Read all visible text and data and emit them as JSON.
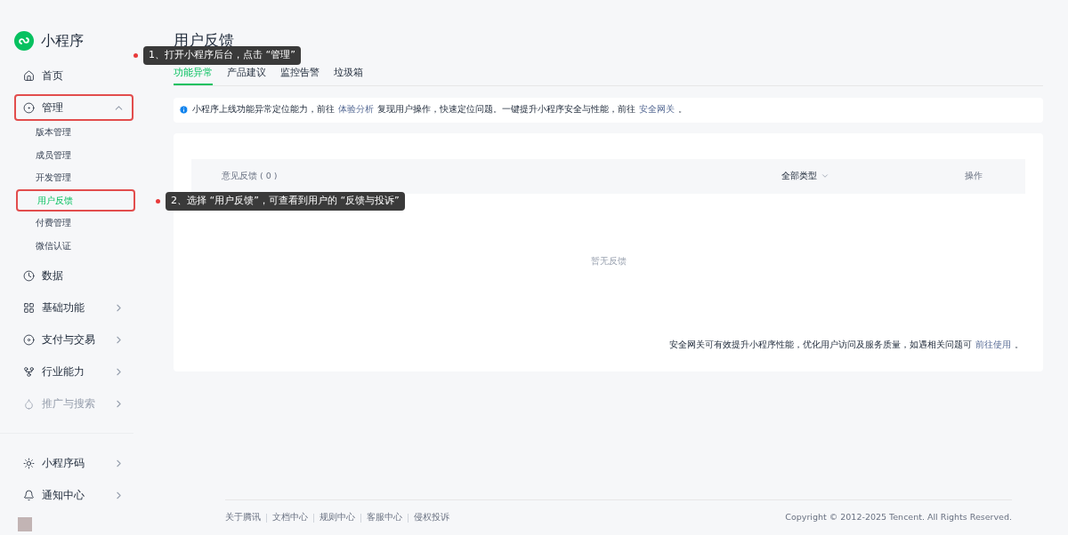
{
  "sidebar": {
    "logo_text": "小程序",
    "nav": [
      {
        "label": "首页",
        "kind": "item",
        "dimmed": false,
        "highlighted": false
      },
      {
        "label": "管理",
        "kind": "group",
        "expanded": true,
        "dimmed": false,
        "highlighted": true,
        "children": [
          {
            "label": "版本管理",
            "selected": false,
            "highlighted": false
          },
          {
            "label": "成员管理",
            "selected": false,
            "highlighted": false
          },
          {
            "label": "开发管理",
            "selected": false,
            "highlighted": false
          },
          {
            "label": "用户反馈",
            "selected": true,
            "highlighted": true
          },
          {
            "label": "付费管理",
            "selected": false,
            "highlighted": false
          },
          {
            "label": "微信认证",
            "selected": false,
            "highlighted": false
          }
        ]
      },
      {
        "label": "数据",
        "kind": "item",
        "dimmed": false,
        "highlighted": false
      },
      {
        "label": "基础功能",
        "kind": "group",
        "expanded": false,
        "dimmed": false,
        "highlighted": false
      },
      {
        "label": "支付与交易",
        "kind": "group",
        "expanded": false,
        "dimmed": false,
        "highlighted": false
      },
      {
        "label": "行业能力",
        "kind": "group",
        "expanded": false,
        "dimmed": false,
        "highlighted": false
      },
      {
        "label": "推广与搜索",
        "kind": "group",
        "expanded": false,
        "dimmed": true,
        "highlighted": false
      }
    ],
    "bottom_nav": [
      {
        "label": "小程序码",
        "kind": "group",
        "expanded": false,
        "dimmed": false,
        "highlighted": false
      },
      {
        "label": "通知中心",
        "kind": "group",
        "expanded": false,
        "dimmed": false,
        "highlighted": false
      }
    ]
  },
  "page_title": "用户反馈",
  "tabs": [
    {
      "label": "功能异常",
      "selected": true
    },
    {
      "label": "产品建议",
      "selected": false
    },
    {
      "label": "监控告警",
      "selected": false
    },
    {
      "label": "垃圾箱",
      "selected": false
    }
  ],
  "notice": {
    "parts": [
      {
        "kind": "text",
        "text": "小程序上线功能异常定位能力，前往"
      },
      {
        "kind": "link",
        "text": "体验分析"
      },
      {
        "kind": "text",
        "text": "复现用户操作，快速定位问题。一键提升小程序安全与性能，前往"
      },
      {
        "kind": "link",
        "text": "安全网关"
      },
      {
        "kind": "text",
        "text": "。"
      }
    ]
  },
  "table": {
    "columns": [
      {
        "label": "意见反馈 ( 0 )",
        "kind": "plain"
      },
      {
        "label": "全部类型",
        "kind": "filter"
      },
      {
        "label": "操作",
        "kind": "plain"
      }
    ],
    "empty_text": "暂无反馈"
  },
  "bottom_note": {
    "parts": [
      {
        "kind": "text",
        "text": "安全网关可有效提升小程序性能，优化用户访问及服务质量，如遇相关问题可"
      },
      {
        "kind": "link",
        "text": "前往使用"
      },
      {
        "kind": "text",
        "text": "。"
      }
    ]
  },
  "footer": {
    "links": [
      "关于腾讯",
      "文档中心",
      "规则中心",
      "客服中心",
      "侵权投诉"
    ],
    "copyright": "Copyright © 2012-2025 Tencent. All Rights Reserved."
  },
  "callouts": [
    {
      "text": "1、打开小程序后台，点击 “管理”"
    },
    {
      "text": "2、选择 “用户反馈”，可查看到用户的 “反馈与投诉”"
    }
  ]
}
